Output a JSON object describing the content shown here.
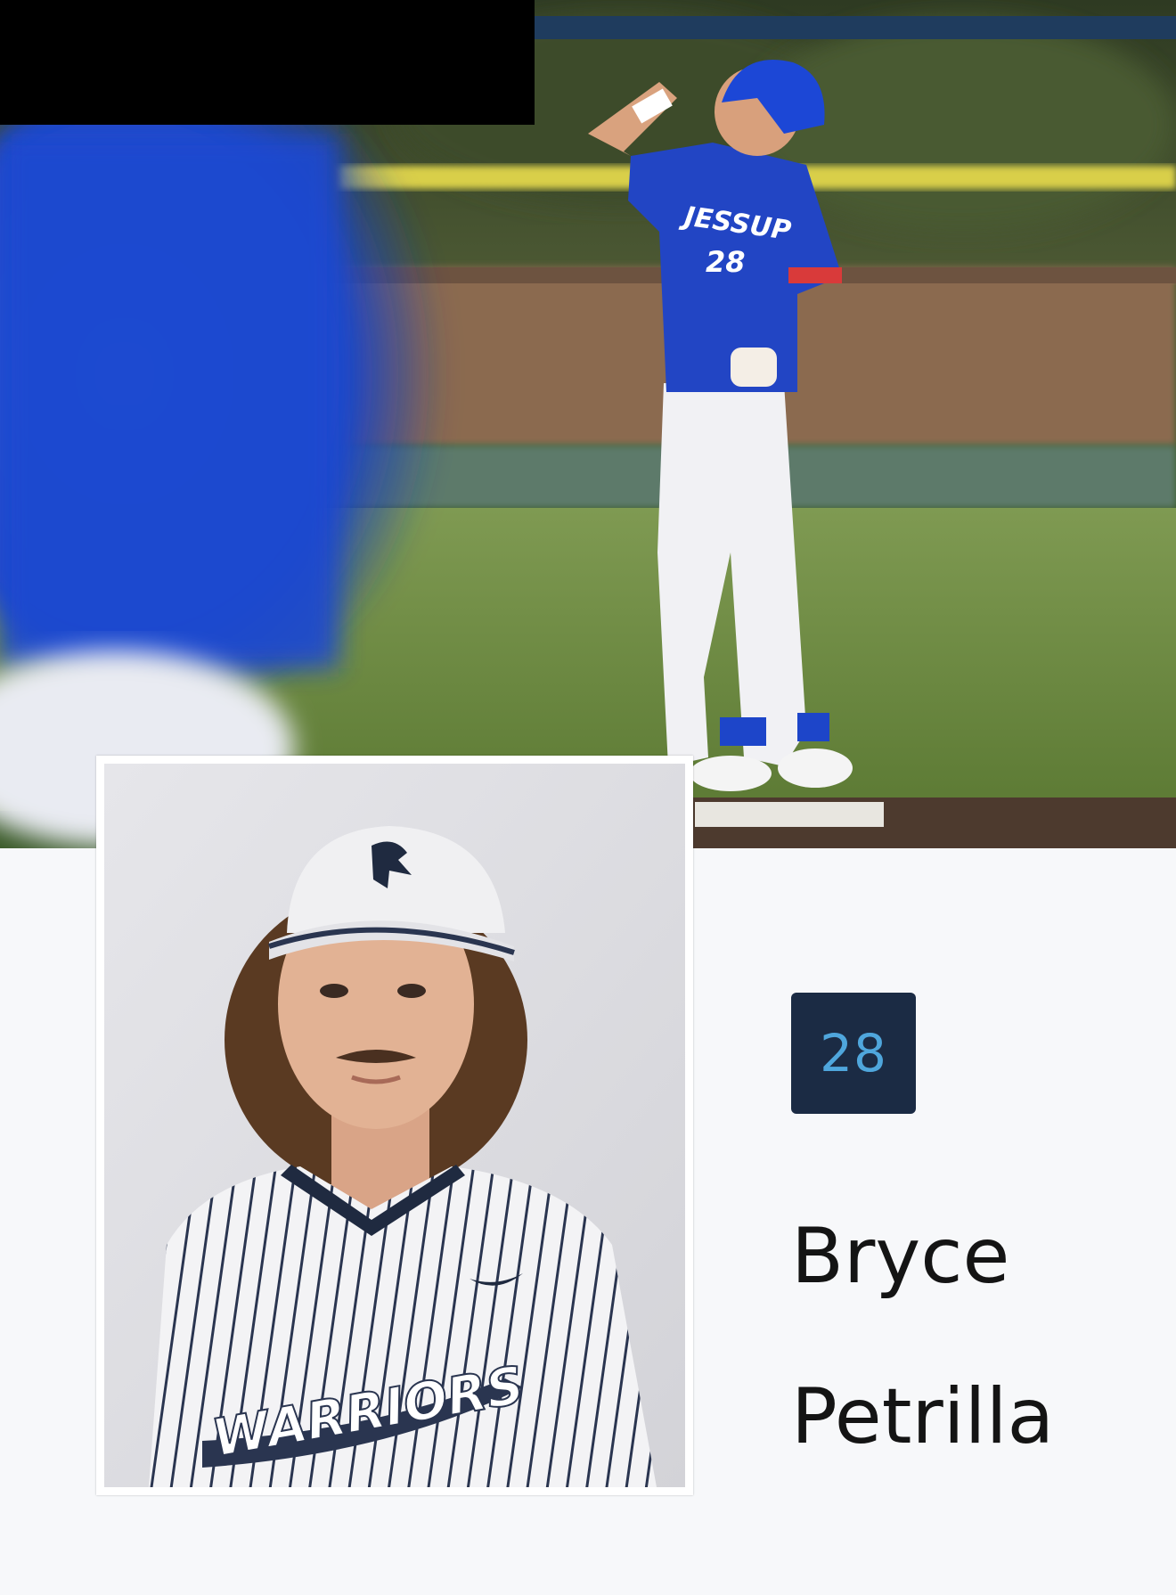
{
  "hero_photo": {
    "jersey_text": "JESSUP",
    "jersey_number": "28"
  },
  "headshot": {
    "jersey_text": "WARRIORS"
  },
  "player": {
    "number": "28",
    "first_name": "Bryce",
    "last_name": "Petrilla"
  },
  "colors": {
    "badge_background": "#1b2b44",
    "badge_number": "#4fa6dc",
    "top_bar": "#1f3c5e",
    "page_background": "#f7f8fa"
  }
}
